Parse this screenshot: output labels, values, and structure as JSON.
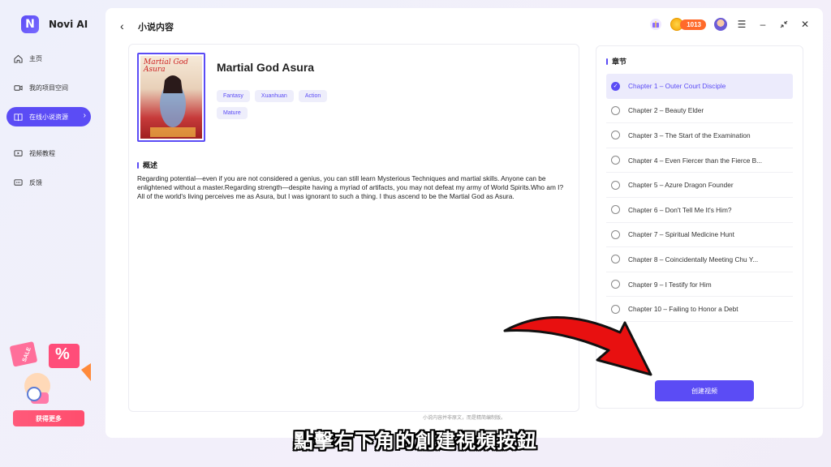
{
  "app": {
    "name": "Novi AI",
    "logo": "N"
  },
  "sidebar": {
    "items": [
      {
        "label": "主页",
        "icon": "home-icon"
      },
      {
        "label": "我的项目空间",
        "icon": "video-icon"
      },
      {
        "label": "在线小说资源",
        "icon": "book-icon",
        "active": true
      },
      {
        "label": "视频教程",
        "icon": "tutorial-icon"
      },
      {
        "label": "反馈",
        "icon": "feedback-icon"
      }
    ],
    "promo_tag": "%",
    "promo_sale": "SALE",
    "promo_button": "获得更多"
  },
  "header": {
    "title": "小说内容",
    "coins": "1013"
  },
  "book": {
    "cover_title": "Martial God Asura",
    "title": "Martial God Asura",
    "tags": [
      "Fantasy",
      "Xuanhuan",
      "Action",
      "Mature"
    ],
    "synopsis_heading": "概述",
    "synopsis": "Regarding potential—even if you are not considered a genius, you can still learn Mysterious Techniques and martial skills. Anyone can be enlightened without a master.Regarding strength—despite having a myriad of artifacts, you may not defeat my army of World Spirits.Who am I? All of the world's  living perceives me as Asura, but I was ignorant to such a thing. I thus ascend to be the Martial God as Asura."
  },
  "chapters": {
    "heading": "章节",
    "items": [
      "Chapter 1 – Outer Court Disciple",
      "Chapter 2 – Beauty Elder",
      "Chapter 3 – The Start of the Examination",
      "Chapter 4 – Even Fiercer than the Fierce B...",
      "Chapter 5 – Azure Dragon Founder",
      "Chapter 6 – Don't Tell Me It's Him?",
      "Chapter 7 – Spiritual Medicine Hunt",
      "Chapter 8 – Coincidentally Meeting Chu Y...",
      "Chapter 9 – I Testify for Him",
      "Chapter 10 – Failing to Honor a Debt"
    ],
    "selected_index": 0,
    "create_button": "创建视频"
  },
  "footnote": "小说内容并非原文，而是精简编制版。",
  "subtitle": "點擊右下角的創建視頻按鈕",
  "colors": {
    "accent": "#5b4cf5",
    "arrow": "#e81010"
  }
}
